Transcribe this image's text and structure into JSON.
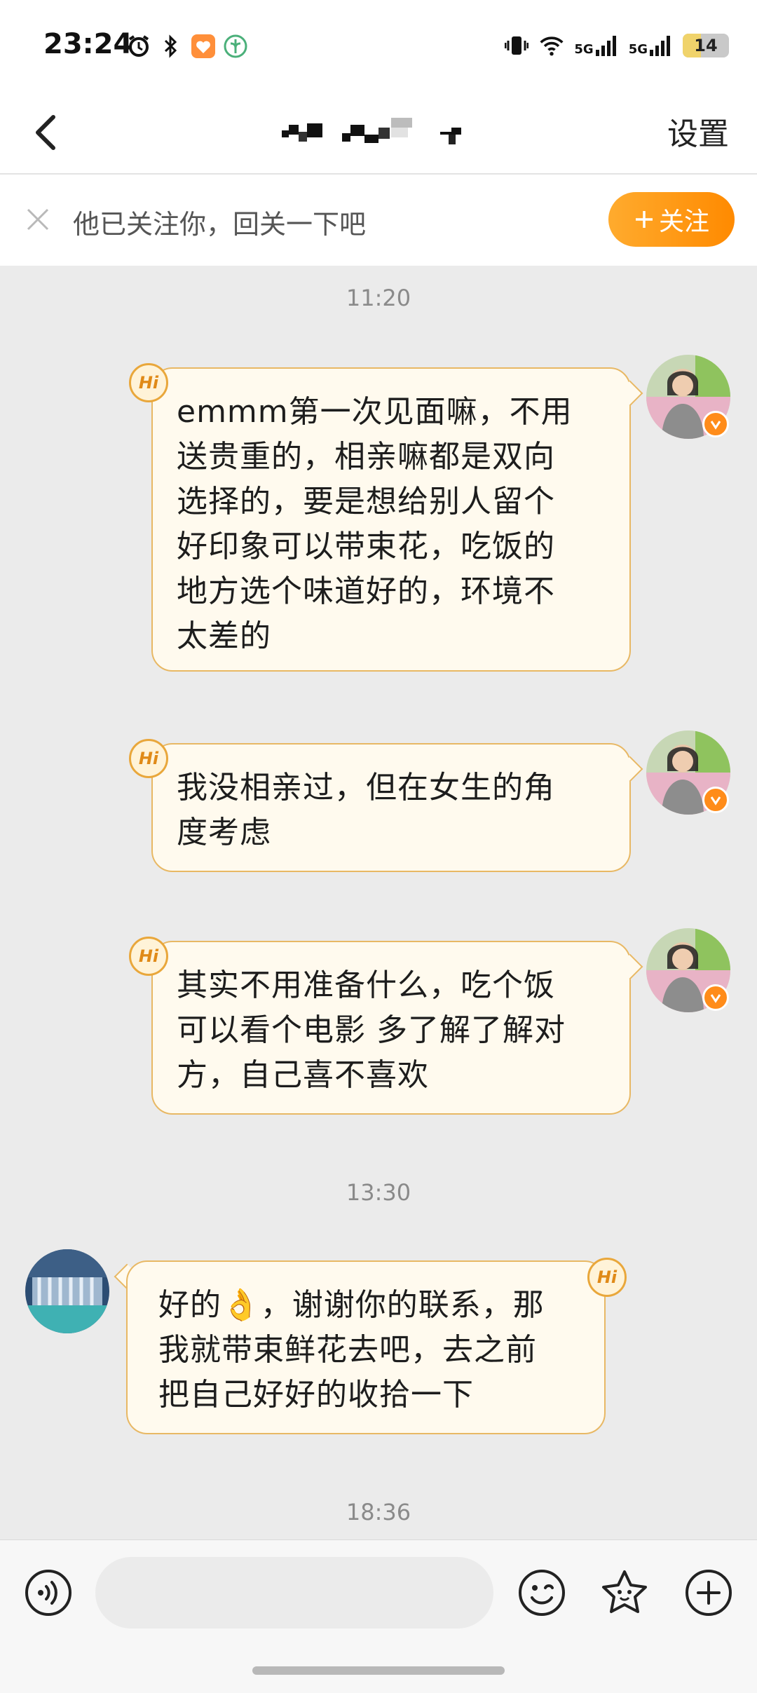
{
  "status_bar": {
    "time": "23:24",
    "battery_level": "14",
    "net_a": "5G",
    "net_b": "5G",
    "icons_left": [
      "alarm-icon",
      "bluetooth-icon",
      "health-app-icon",
      "green-app-icon"
    ],
    "icons_right": [
      "vibrate-icon",
      "wifi-icon",
      "signal-icon",
      "signal-icon",
      "battery-icon"
    ]
  },
  "header": {
    "settings_label": "设置",
    "online_color": "#3cc65b"
  },
  "follow_bar": {
    "text": "他已关注你，回关一下吧",
    "follow_label": "关注",
    "accent": "#ff9a1a"
  },
  "chat": {
    "timestamps": [
      "11:20",
      "13:30",
      "18:36"
    ],
    "messages": [
      {
        "side": "right",
        "badge": "Hi",
        "lines": [
          "emmm第一次见面嘛，不用",
          "送贵重的，相亲嘛都是双向",
          "选择的，要是想给别人留个",
          "好印象可以带束花，吃饭的",
          "地方选个味道好的，环境不",
          "太差的"
        ]
      },
      {
        "side": "right",
        "badge": "Hi",
        "lines": [
          "我没相亲过，但在女生的角",
          "度考虑"
        ]
      },
      {
        "side": "right",
        "badge": "Hi",
        "lines": [
          "其实不用准备什么，吃个饭",
          "可以看个电影 多了解了解对",
          "方，自己喜不喜欢"
        ]
      },
      {
        "side": "left",
        "badge": "Hi",
        "lines": [
          "好的👌，谢谢你的联系，那",
          "我就带束鲜花去吧，去之前",
          "把自己好好的收拾一下"
        ]
      }
    ]
  },
  "bottom_bar": {
    "input_placeholder": "",
    "icons": [
      "voice-icon",
      "emoji-icon",
      "sticker-icon",
      "plus-icon"
    ]
  }
}
